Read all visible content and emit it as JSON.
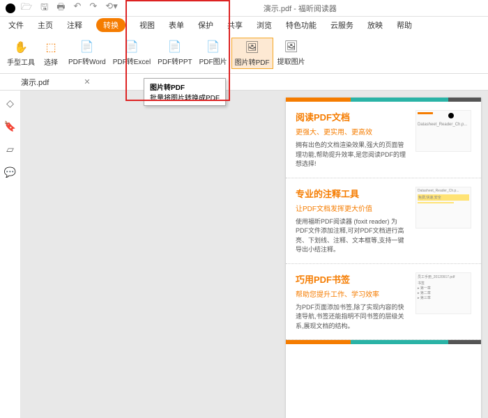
{
  "titlebar": {
    "title": "演示.pdf - 福昕阅读器"
  },
  "menubar": {
    "items": [
      "文件",
      "主页",
      "注释",
      "转换",
      "视图",
      "表单",
      "保护",
      "共享",
      "浏览",
      "特色功能",
      "云服务",
      "放映",
      "帮助"
    ],
    "activeIndex": 3
  },
  "toolbar": {
    "items": [
      {
        "label": "手型工具",
        "icon": "✋"
      },
      {
        "label": "选择",
        "icon": "▭"
      },
      {
        "label": "PDF转Word",
        "icon": "📄"
      },
      {
        "label": "PDF转Excel",
        "icon": "📄"
      },
      {
        "label": "PDF转PPT",
        "icon": "📄"
      },
      {
        "label": "PDF图片",
        "icon": "📄"
      },
      {
        "label": "图片转PDF",
        "icon": "🖼"
      },
      {
        "label": "提取图片",
        "icon": "🖼"
      }
    ],
    "highlightedIndex": 6
  },
  "tooltip": {
    "title": "图片转PDF",
    "desc": "批量将图片转换成PDF"
  },
  "tab": {
    "name": "演示.pdf"
  },
  "sections": [
    {
      "title": "阅读PDF文档",
      "sub": "更强大、更实用、更高效",
      "body": "拥有出色的文档渲染效果,强大的页面管理功能,帮助提升效率,是您阅读PDF的理想选择!",
      "thumb_text": "Datasheet_Reader_Ch.p..."
    },
    {
      "title": "专业的注释工具",
      "sub": "让PDF文档发挥更大价值",
      "body": "使用福昕PDF阅读器 (foxit reader) 为PDF文件添加注释,可对PDF文档进行高亮、下划线、注释、文本框等,支持一键导出小结注释。",
      "thumb_text": "免费,快速,安全"
    },
    {
      "title": "巧用PDF书签",
      "sub": "帮助您提升工作、学习效率",
      "body": "为PDF页面添加书签,除了实现内容的快速导航,书签还能指明不同书签的层级关系,展现文档的结构。",
      "thumb_text": "员工手册_20120917.pdf"
    }
  ]
}
